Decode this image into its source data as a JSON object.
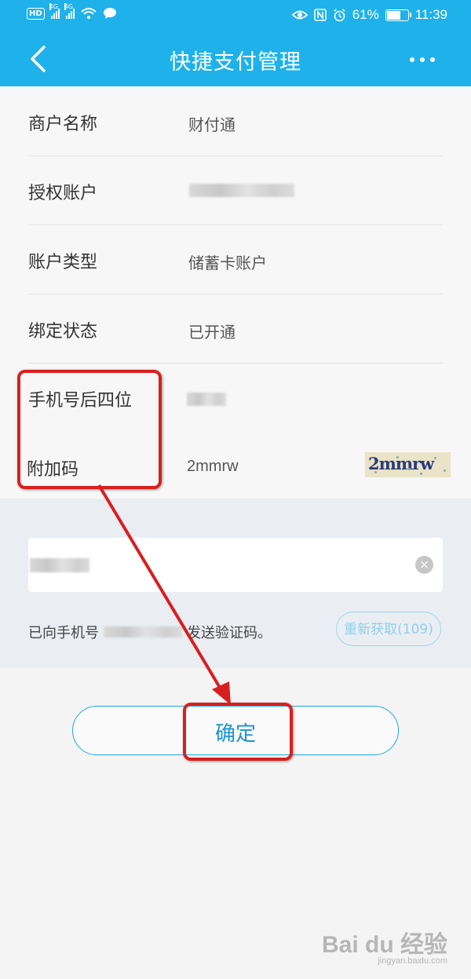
{
  "status_bar": {
    "hd_label": "HD",
    "network_label": "4G",
    "network2_label": "4G",
    "battery_text": "61%",
    "battery_level": 0.61,
    "time": "11:39"
  },
  "header": {
    "title": "快捷支付管理"
  },
  "info": {
    "rows": [
      {
        "label": "商户名称",
        "value": "财付通"
      },
      {
        "label": "授权账户",
        "value": ""
      },
      {
        "label": "账户类型",
        "value": "储蓄卡账户"
      },
      {
        "label": "绑定状态",
        "value": "已开通"
      },
      {
        "label": "手机号后四位",
        "value": ""
      },
      {
        "label": "附加码",
        "value": "2mmrw"
      }
    ],
    "captcha_text": "2mmrw"
  },
  "verify": {
    "sent_prefix": "已向手机号",
    "sent_suffix": "发送验证码。",
    "resend_label": "重新获取(109)",
    "clear_icon": "×"
  },
  "confirm_label": "确定",
  "watermark": {
    "main": "Bai du 经验",
    "sub": "jingyan.baidu.com"
  },
  "colors": {
    "header_bg": "#1fb2ea",
    "annotation": "#d81f1f",
    "confirm_text": "#1b94d2"
  }
}
